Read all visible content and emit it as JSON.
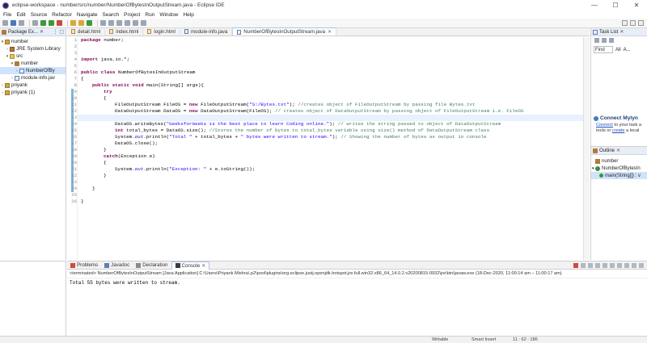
{
  "window": {
    "title": "eclipse-workspace - number/src/number/NumberOfBytesInOutputStream.java - Eclipse IDE"
  },
  "menu": [
    "File",
    "Edit",
    "Source",
    "Refactor",
    "Navigate",
    "Search",
    "Project",
    "Run",
    "Window",
    "Help"
  ],
  "package_explorer": {
    "tab_label": "Package Ex...",
    "items": [
      {
        "label": "number",
        "level": 0
      },
      {
        "label": "JRE System Library",
        "level": 1
      },
      {
        "label": "src",
        "level": 1
      },
      {
        "label": "number",
        "level": 2
      },
      {
        "label": "NumberOfBy",
        "level": 3
      },
      {
        "label": "module-info.jav",
        "level": 2
      },
      {
        "label": "priyank",
        "level": 0
      },
      {
        "label": "priyank (1)",
        "level": 0
      }
    ]
  },
  "editor": {
    "tabs": [
      "detail.html",
      "index.html",
      "login.html",
      "module-info.java",
      "NumberOfBytesInOutputStream.java"
    ],
    "line_numbers": [
      "1",
      "2",
      "3",
      "4",
      "5",
      "6",
      "7",
      "8",
      "9",
      "10",
      "11",
      "12",
      "13",
      "14",
      "15",
      "16",
      "17",
      "18",
      "19",
      "20",
      "21",
      "22",
      "23",
      "24",
      "25",
      "26"
    ],
    "lines": {
      "l1_kw": "package",
      "l1_rest": " number;",
      "l3_kw": "import",
      "l3_rest": " java.io.*;",
      "l5_kw1": "public",
      "l5_kw2": "class",
      "l5_rest": " NumberOfBytesInOutputStream",
      "l6": "{",
      "l7_kw1": "public",
      "l7_kw2": "static",
      "l7_kw3": "void",
      "l7_rest": " main(String[] args){",
      "l8_kw": "try",
      "l9": "{",
      "l10_a": "FileOutputStream FileOS = ",
      "l10_kw": "new",
      "l10_b": " FileOutputStream(",
      "l10_str": "\"S:/Bytes.txt\"",
      "l10_c": "); ",
      "l10_cm": "//creates object of FileOutputStream by passing file Bytes.txt",
      "l11_a": "DataOutputStream DataOS = ",
      "l11_kw": "new",
      "l11_b": " DataOutputStream(FileOS); ",
      "l11_cm": "// creates object of DataOutputStream by passing object of FileOutputStream i.e. FileOS",
      "l13_a": "DataOS.writeBytes(",
      "l13_str": "\"GeeksforGeeks is the best place to learn Coding online.\"",
      "l13_b": "); ",
      "l13_cm": "// writes the string passed to object of DataOutputStream",
      "l14_kw": "int",
      "l14_a": " total_bytes = DataOS.size(); ",
      "l14_cm": "//Stores the number of bytes to total_bytes variable using size() method of DataOutputStream class",
      "l15_a": "System.",
      "l15_fld": "out",
      "l15_b": ".println(",
      "l15_str1": "\"Total \"",
      "l15_c": " + total_bytes + ",
      "l15_str2": "\" bytes were written to stream.\"",
      "l15_d": "); ",
      "l15_cm": "// Showing the number of bytes as output in console",
      "l16": "DataOS.close();",
      "l17": "}",
      "l18_kw": "catch",
      "l18_rest": "(Exception e)",
      "l19": "{",
      "l20_a": "System.",
      "l20_fld": "out",
      "l20_b": ".println(",
      "l20_str": "\"Exception: \"",
      "l20_c": " + e.toString());",
      "l21": "}",
      "l23": "}",
      "l25": "}"
    }
  },
  "task_list": {
    "tab_label": "Task List",
    "find_placeholder": "Find",
    "all": "All",
    "activate": "A..."
  },
  "mylyn": {
    "title": "Connect Mylyn",
    "link1": "Connect",
    "text1": " to your task a",
    "text2": "tools or ",
    "link2": "create",
    "text3": " a local"
  },
  "outline": {
    "tab_label": "Outline",
    "items": [
      "number",
      "NumberOfBytesIn",
      "main(String[]) : v"
    ]
  },
  "console": {
    "tabs": [
      "Problems",
      "Javadoc",
      "Declaration",
      "Console"
    ],
    "info": "<terminated> NumberOfBytesInOutputStream [Java Application] C:\\Users\\Priyank Mishra\\.p2\\pool\\plugins\\org.eclipse.justj.openjdk.hotspot.jre.full.win32.x86_64_14.0.2.v20200815-0932\\jre\\bin\\javaw.exe  (18-Dec-2020, 11:00:14 am – 11:00:17 am)",
    "output": "Total 55 bytes were written to stream."
  },
  "status": {
    "writable": "Writable",
    "insert": "Smart Insert",
    "position": "11 : 62 : 186"
  }
}
